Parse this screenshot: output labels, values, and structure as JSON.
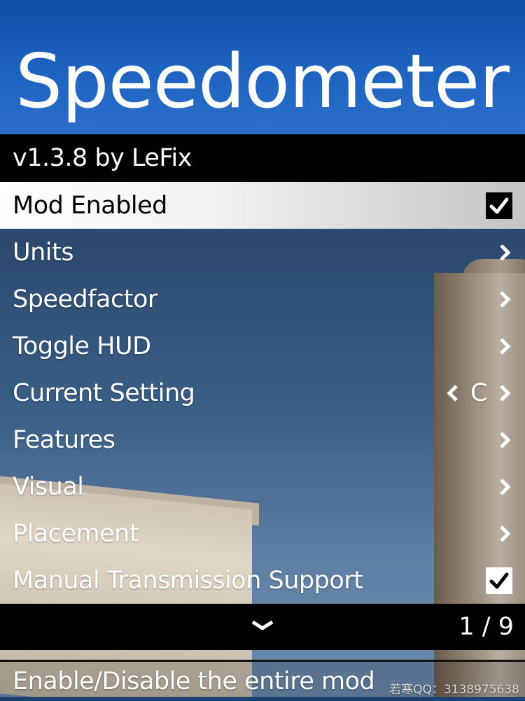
{
  "header": {
    "title": "Speedometer"
  },
  "subtitle": "v1.3.8 by LeFix",
  "items": [
    {
      "label": "Mod Enabled"
    },
    {
      "label": "Units"
    },
    {
      "label": "Speedfactor"
    },
    {
      "label": "Toggle HUD"
    },
    {
      "label": "Current Setting",
      "value": "C"
    },
    {
      "label": "Features"
    },
    {
      "label": "Visual"
    },
    {
      "label": "Placement"
    },
    {
      "label": "Manual Transmission Support"
    }
  ],
  "footer": {
    "page_indicator": "1 / 9"
  },
  "description": "Enable/Disable the entire mod",
  "watermark": "若寒QQ：3138975638",
  "icons": {
    "checked": "checkmark-icon",
    "submenu": "chevron-right-icon",
    "scroll": "chevron-down-icon"
  }
}
